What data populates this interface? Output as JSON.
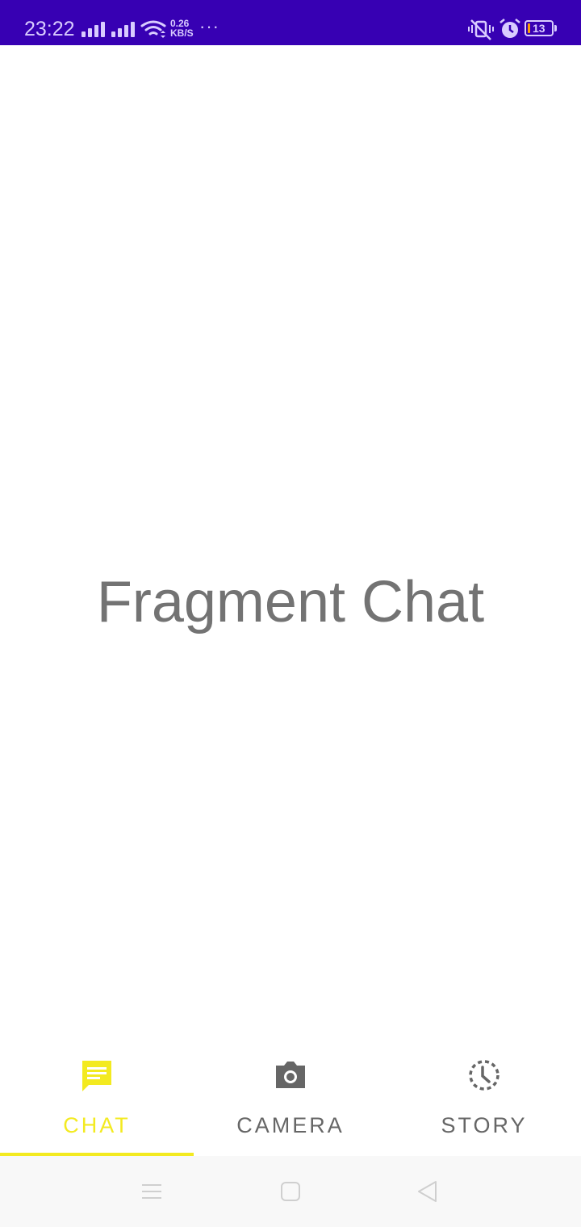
{
  "status_bar": {
    "time": "23:22",
    "net_speed_value": "0.26",
    "net_speed_unit": "KB/S",
    "overflow": "···",
    "battery_level": "13",
    "background_color": "#3700b3"
  },
  "content": {
    "fragment_label": "Fragment Chat"
  },
  "tabs": [
    {
      "label": "CHAT",
      "icon": "chat-icon",
      "active": true
    },
    {
      "label": "CAMERA",
      "icon": "camera-icon",
      "active": false
    },
    {
      "label": "STORY",
      "icon": "story-clock-icon",
      "active": false
    }
  ],
  "colors": {
    "accent": "#f3ea20",
    "inactive": "#666666",
    "text_gray": "#737373"
  },
  "nav_bar": {
    "buttons": [
      "menu-icon",
      "home-icon",
      "back-icon"
    ]
  }
}
